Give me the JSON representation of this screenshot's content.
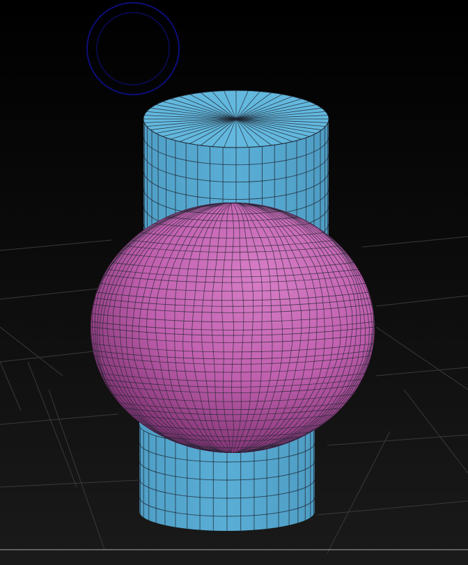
{
  "viewport": {
    "background_top": "#000000",
    "background_bottom": "#1a1a1a",
    "grid_color": "#3a3a3a",
    "floor_line_color": "#8a8a8a",
    "brush_cursor_color": "#0d0d7a",
    "brush_cursor_icon": "brush-cursor-icon"
  },
  "model": {
    "cylinder_color": "#5aaed6",
    "cylinder_top_color": "#63b8de",
    "sphere_color": "#c05fae",
    "sphere_highlight": "#d77ec6",
    "sphere_shadow": "#7b2f6d",
    "wire_color": "#1d2430"
  }
}
